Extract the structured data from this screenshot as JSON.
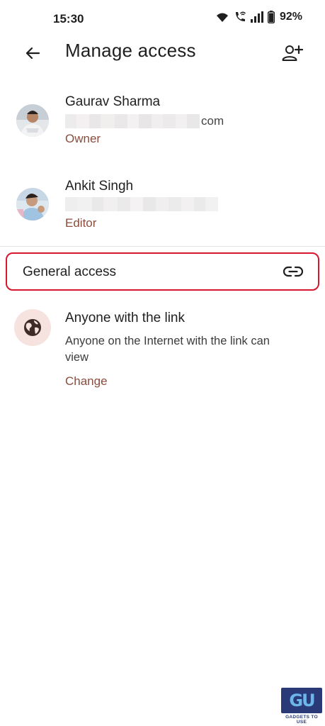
{
  "status_bar": {
    "time": "15:30",
    "battery_percent": "92%",
    "icons": [
      "wifi-icon",
      "wifi-calling-icon",
      "signal-icon",
      "battery-icon"
    ]
  },
  "app_bar": {
    "title": "Manage access",
    "back_icon": "arrow-back-icon",
    "add_person_icon": "person-add-icon"
  },
  "people": [
    {
      "name": "Gaurav Sharma",
      "email_suffix": "com",
      "role": "Owner"
    },
    {
      "name": "Ankit Singh",
      "email_suffix": "",
      "role": "Editor"
    }
  ],
  "general_access": {
    "label": "General access",
    "icon": "link-icon"
  },
  "link_access": {
    "icon": "globe-icon",
    "title": "Anyone with the link",
    "description": "Anyone on the Internet with the link can view",
    "change_label": "Change"
  },
  "colors": {
    "accent": "#8a4d3e",
    "highlight_border": "#d7172f",
    "globe_bg": "#f6e2df"
  },
  "watermark": {
    "letters": "GU",
    "text": "GADGETS TO USE"
  }
}
